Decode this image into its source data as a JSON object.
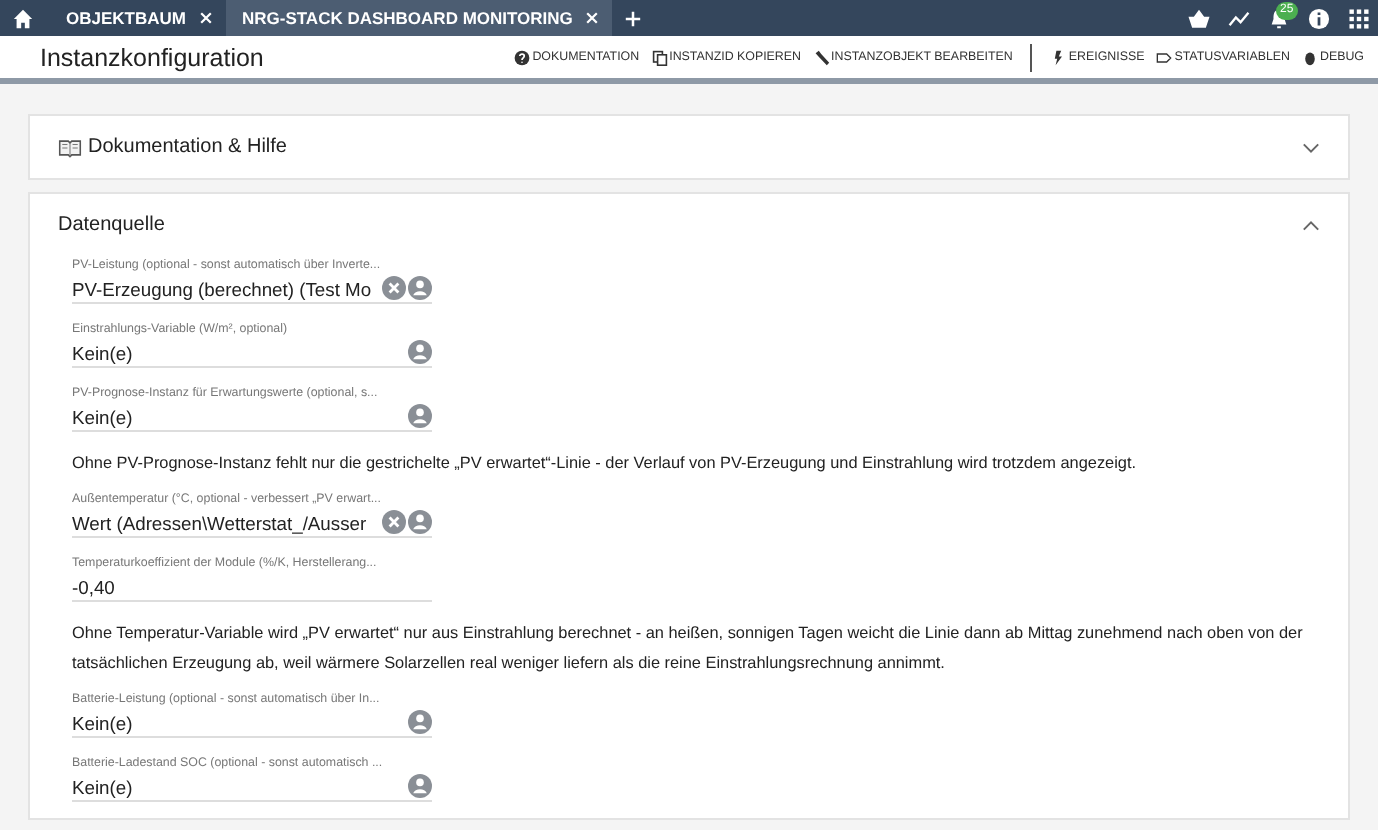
{
  "tabs": [
    {
      "label": "OBJEKTBAUM",
      "selected": false
    },
    {
      "label": "NRG-STACK DASHBOARD MONITORING",
      "selected": true
    }
  ],
  "notifications": {
    "count": "25"
  },
  "header": {
    "title": "Instanzkonfiguration"
  },
  "toolbar": [
    {
      "label": "DOKUMENTATION"
    },
    {
      "label": "INSTANZID KOPIEREN"
    },
    {
      "label": "INSTANZOBJEKT BEARBEITEN"
    },
    {
      "label": "EREIGNISSE"
    },
    {
      "label": "STATUSVARIABLEN"
    },
    {
      "label": "DEBUG"
    }
  ],
  "panels": [
    {
      "title": "Dokumentation & Hilfe",
      "expanded": false
    },
    {
      "title": "Datenquelle",
      "expanded": true
    }
  ],
  "datasource": [
    {
      "kind": "select",
      "label": "PV-Leistung (optional - sonst automatisch über Inverte...",
      "value": "PV-Erzeugung (berechnet) (Test Mo",
      "clearable": true
    },
    {
      "kind": "select",
      "label": "Einstrahlungs-Variable (W/m², optional)",
      "value": "Kein(e)",
      "clearable": false
    },
    {
      "kind": "select",
      "label": "PV-Prognose-Instanz für Erwartungswerte (optional, s...",
      "value": "Kein(e)",
      "clearable": false
    },
    {
      "kind": "note",
      "text": "Ohne PV-Prognose-Instanz fehlt nur die gestrichelte „PV erwartet“-Linie - der Verlauf von PV-Erzeugung und Einstrahlung wird trotzdem angezeigt."
    },
    {
      "kind": "select",
      "label": "Außentemperatur (°C, optional - verbessert „PV erwart...",
      "value": "Wert (Adressen\\Wetterstat_/Ausser",
      "clearable": true
    },
    {
      "kind": "number",
      "label": "Temperaturkoeffizient der Module (%/K, Herstellerang...",
      "value": "-0,40"
    },
    {
      "kind": "note",
      "text": "Ohne Temperatur-Variable wird „PV erwartet“ nur aus Einstrahlung berechnet - an heißen, sonnigen Tagen weicht die Linie dann ab Mittag zunehmend nach oben von der tatsächlichen Erzeugung ab, weil wärmere Solarzellen real weniger liefern als die reine Einstrahlungsrechnung annimmt."
    },
    {
      "kind": "select",
      "label": "Batterie-Leistung (optional - sonst automatisch über In...",
      "value": "Kein(e)",
      "clearable": false
    },
    {
      "kind": "select",
      "label": "Batterie-Ladestand SOC (optional - sonst automatisch ...",
      "value": "Kein(e)",
      "clearable": false
    }
  ]
}
